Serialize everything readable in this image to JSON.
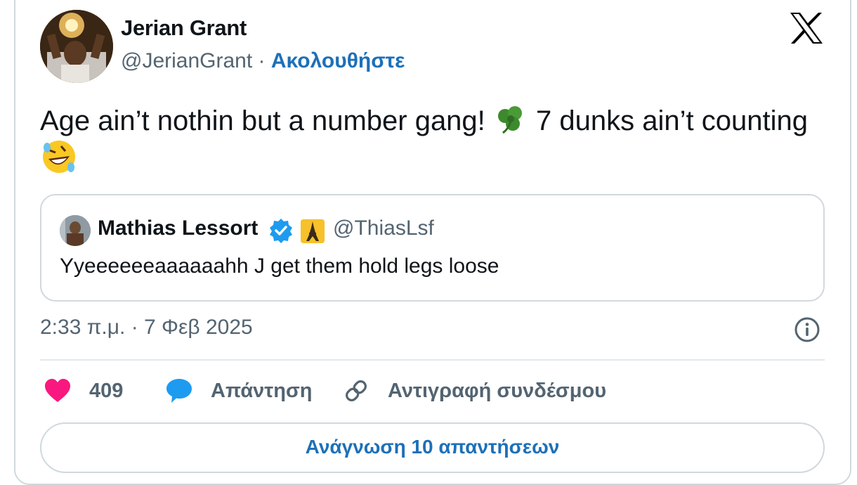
{
  "author": {
    "name": "Jerian Grant",
    "handle": "@JerianGrant",
    "separator": "·",
    "follow_label": "Ακολουθήστε"
  },
  "tweet": {
    "text_part1": "Age ain’t nothin but a number gang!",
    "text_part2": "7 dunks ain’t counting",
    "emoji_1": "shamrock-icon",
    "emoji_2": "rolling-on-floor-laughing-icon"
  },
  "quoted_tweet": {
    "name": "Mathias Lessort",
    "handle": "@ThiasLsf",
    "text": "Yyeeeeeeaaaaaahh J get them hold legs loose"
  },
  "timestamp": "2:33 π.μ. · 7 Φεβ 2025",
  "actions": {
    "like_count": "409",
    "reply_label": "Απάντηση",
    "copy_link_label": "Αντιγραφή συνδέσμου"
  },
  "read_replies_label": "Ανάγνωση 10 απαντήσεων",
  "colors": {
    "link_blue": "#1d70b8",
    "heart_pink": "#f91880",
    "reply_blue": "#1d9bf0",
    "muted_text": "#536471",
    "border": "#cfd9de"
  }
}
